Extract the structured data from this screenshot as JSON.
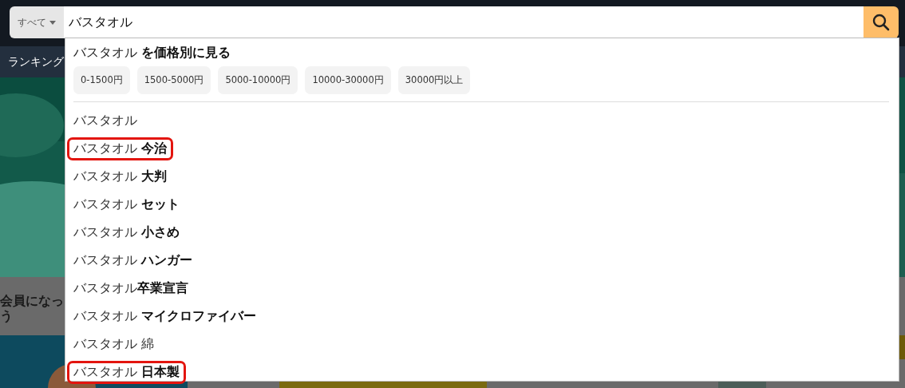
{
  "search": {
    "category": "すべて",
    "value": "バスタオル"
  },
  "nav": {
    "items": [
      "ランキング"
    ]
  },
  "promo": {
    "lines": [
      "会員になっ",
      "う"
    ]
  },
  "dropdown": {
    "price_heading": "バスタオル **を価格別に見る**",
    "price_ranges": [
      "0-1500円",
      "1500-5000円",
      "5000-10000円",
      "10000-30000円",
      "30000円以上"
    ],
    "suggestions": [
      {
        "text": "バスタオル",
        "highlighted": false
      },
      {
        "text": "バスタオル **今治**",
        "highlighted": true
      },
      {
        "text": "バスタオル **大判**",
        "highlighted": false
      },
      {
        "text": "バスタオル **セット**",
        "highlighted": false
      },
      {
        "text": "バスタオル **小さめ**",
        "highlighted": false
      },
      {
        "text": "バスタオル **ハンガー**",
        "highlighted": false
      },
      {
        "text": "バスタオル**卒業宣言**",
        "highlighted": false
      },
      {
        "text": "バスタオル **マイクロファイバー**",
        "highlighted": false
      },
      {
        "text": "バスタオル 綿",
        "highlighted": false
      },
      {
        "text": "バスタオル **日本製**",
        "highlighted": true
      }
    ]
  }
}
